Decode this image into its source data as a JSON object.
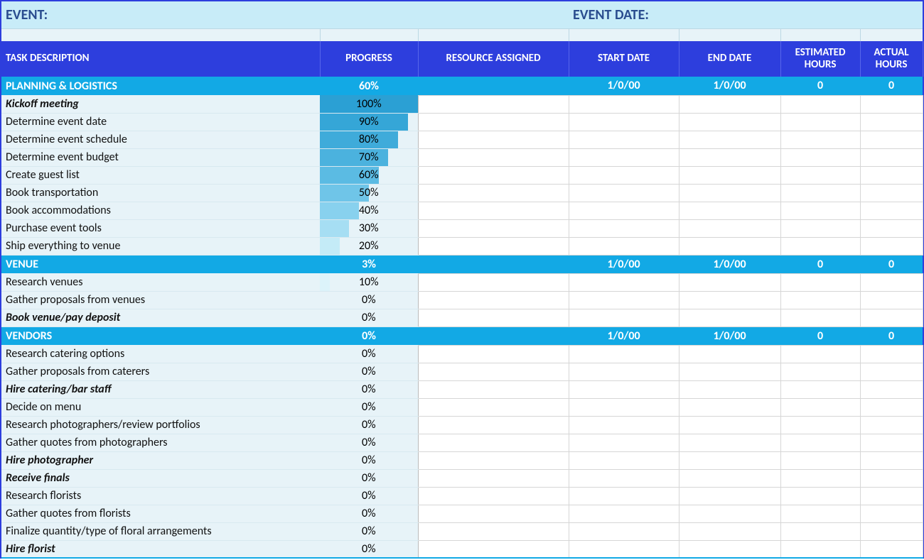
{
  "header": {
    "event_label": "EVENT:",
    "event_date_label": "EVENT DATE:"
  },
  "columns": {
    "task": "TASK DESCRIPTION",
    "progress": "PROGRESS",
    "resource": "RESOURCE ASSIGNED",
    "start": "START DATE",
    "end": "END DATE",
    "est": "ESTIMATED HOURS",
    "act": "ACTUAL HOURS"
  },
  "sections": [
    {
      "name": "PLANNING & LOGISTICS",
      "progress": "60%",
      "start": "1/0/00",
      "end": "1/0/00",
      "est": "0",
      "act": "0",
      "tasks": [
        {
          "desc": "Kickoff meeting",
          "progress": "100%",
          "pct": 100,
          "bold": true
        },
        {
          "desc": "Determine event date",
          "progress": "90%",
          "pct": 90
        },
        {
          "desc": "Determine event schedule",
          "progress": "80%",
          "pct": 80
        },
        {
          "desc": "Determine event budget",
          "progress": "70%",
          "pct": 70
        },
        {
          "desc": "Create guest list",
          "progress": "60%",
          "pct": 60
        },
        {
          "desc": "Book transportation",
          "progress": "50%",
          "pct": 50
        },
        {
          "desc": "Book accommodations",
          "progress": "40%",
          "pct": 40
        },
        {
          "desc": "Purchase event tools",
          "progress": "30%",
          "pct": 30
        },
        {
          "desc": "Ship everything to venue",
          "progress": "20%",
          "pct": 20
        }
      ]
    },
    {
      "name": "VENUE",
      "progress": "3%",
      "start": "1/0/00",
      "end": "1/0/00",
      "est": "0",
      "act": "0",
      "tasks": [
        {
          "desc": "Research venues",
          "progress": "10%",
          "pct": 10
        },
        {
          "desc": "Gather proposals from venues",
          "progress": "0%",
          "pct": 0
        },
        {
          "desc": "Book venue/pay deposit",
          "progress": "0%",
          "pct": 0,
          "bold": true
        }
      ]
    },
    {
      "name": "VENDORS",
      "progress": "0%",
      "start": "1/0/00",
      "end": "1/0/00",
      "est": "0",
      "act": "0",
      "tasks": [
        {
          "desc": "Research catering options",
          "progress": "0%",
          "pct": 0
        },
        {
          "desc": "Gather proposals from caterers",
          "progress": "0%",
          "pct": 0
        },
        {
          "desc": "Hire catering/bar staff",
          "progress": "0%",
          "pct": 0,
          "bold": true
        },
        {
          "desc": "Decide on menu",
          "progress": "0%",
          "pct": 0
        },
        {
          "desc": "Research photographers/review portfolios",
          "progress": "0%",
          "pct": 0
        },
        {
          "desc": "Gather quotes from photographers",
          "progress": "0%",
          "pct": 0
        },
        {
          "desc": "Hire photographer",
          "progress": "0%",
          "pct": 0,
          "bold": true
        },
        {
          "desc": "Receive finals",
          "progress": "0%",
          "pct": 0,
          "bold": true
        },
        {
          "desc": "Research florists",
          "progress": "0%",
          "pct": 0
        },
        {
          "desc": "Gather quotes from florists",
          "progress": "0%",
          "pct": 0
        },
        {
          "desc": "Finalize quantity/type of floral arrangements",
          "progress": "0%",
          "pct": 0
        },
        {
          "desc": "Hire florist",
          "progress": "0%",
          "pct": 0,
          "bold": true
        }
      ]
    }
  ]
}
